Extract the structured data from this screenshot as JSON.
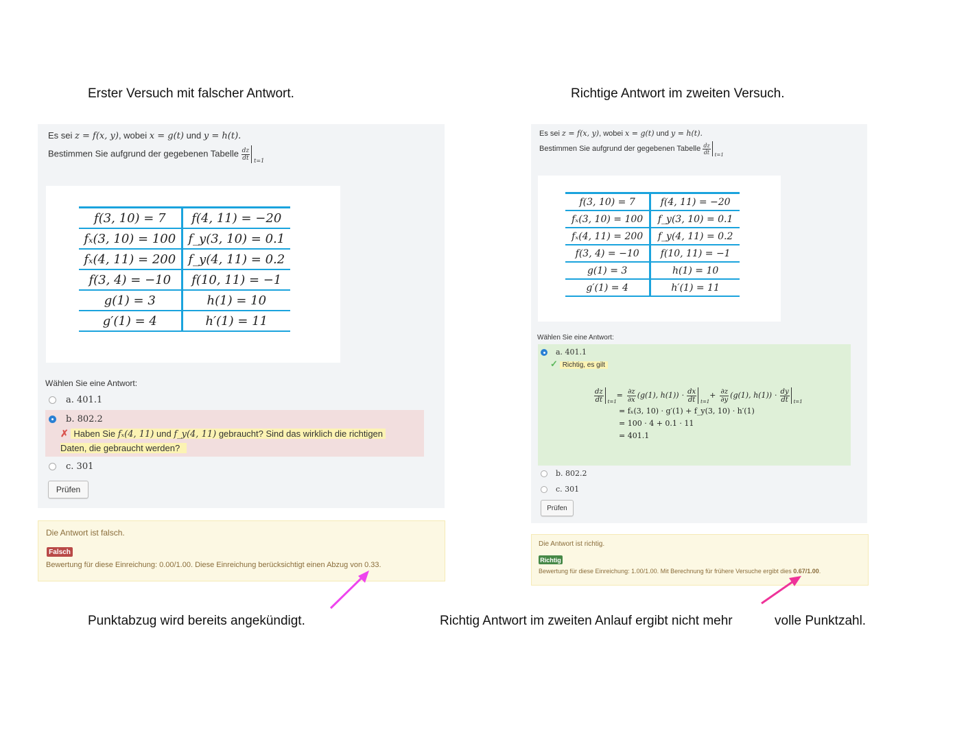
{
  "captions": {
    "left_top": "Erster Versuch mit falscher Antwort.",
    "right_top": "Richtige Antwort im zweiten Versuch.",
    "left_bottom": "Punktabzug wird bereits angekündigt.",
    "right_bottom_a": "Richtig Antwort im zweiten Anlauf ergibt nicht mehr",
    "right_bottom_b": "volle Punktzahl."
  },
  "question": {
    "line1_prefix": "Es sei",
    "line1_z": "z = f(x, y)",
    "line1_mid": ", wobei",
    "line1_x": "x = g(t)",
    "line1_und": "und",
    "line1_y": "y = h(t).",
    "line2_prefix": "Bestimmen Sie aufgrund der gegebenen Tabelle",
    "frac_num": "dz",
    "frac_den": "dt",
    "eval_sub": "t=1"
  },
  "table": [
    [
      "f(3, 10) = 7",
      "f(4, 11) = −20"
    ],
    [
      "fₓ(3, 10) = 100",
      "f_y(3, 10) = 0.1"
    ],
    [
      "fₓ(4, 11) = 200",
      "f_y(4, 11) = 0.2"
    ],
    [
      "f(3, 4) = −10",
      "f(10, 11) = −1"
    ],
    [
      "g(1) = 3",
      "h(1) = 10"
    ],
    [
      "g′(1) = 4",
      "h′(1) = 11"
    ]
  ],
  "choose_label": "Wählen Sie eine Antwort:",
  "options": [
    "a. 401.1",
    "b. 802.2",
    "c. 301"
  ],
  "left_attempt": {
    "selected": "b",
    "feedback_part1": "Haben Sie",
    "feedback_fx": "fₓ(4, 11)",
    "feedback_und": "und",
    "feedback_fy": "f_y(4, 11)",
    "feedback_part2": "gebraucht? Sind das wirklich die richtigen",
    "feedback_line2": "Daten, die gebraucht werden?",
    "check_button": "Prüfen",
    "result_text": "Die Antwort ist falsch.",
    "badge": "Falsch",
    "badge_color": "#b94a48",
    "grade_text": "Bewertung für diese Einreichung: 0.00/1.00. Diese Einreichung berücksichtigt einen Abzug von 0.33."
  },
  "right_attempt": {
    "selected": "a",
    "feedback": "Richtig, es gilt",
    "derivation": {
      "line1_lhs_num": "dz",
      "line1_lhs_den": "dt",
      "line1_sub": "t=1",
      "p1_num": "∂z",
      "p1_den": "∂x",
      "arg": "(g(1), h(1))",
      "d1_num": "dx",
      "d1_den": "dt",
      "p2_num": "∂z",
      "p2_den": "∂y",
      "d2_num": "dy",
      "d2_den": "dt",
      "line2": "= fₓ(3, 10) · g′(1) + f_y(3, 10) · h′(1)",
      "line3": "= 100 · 4 + 0.1 · 11",
      "line4": "= 401.1"
    },
    "check_button": "Prüfen",
    "result_text": "Die Antwort ist richtig.",
    "badge": "Richtig",
    "badge_color": "#468847",
    "grade_text_a": "Bewertung für diese Einreichung: 1.00/1.00. Mit Berechnung für frühere Versuche ergibt dies",
    "grade_text_b": "0.67/1.00",
    "grade_text_c": "."
  },
  "colors": {
    "table_border": "#1aa3dd",
    "wrong_bg": "#f2dede",
    "right_bg": "#dff0d8",
    "feedback_bg": "#fcf8e3",
    "arrow": "#ee44cc"
  }
}
